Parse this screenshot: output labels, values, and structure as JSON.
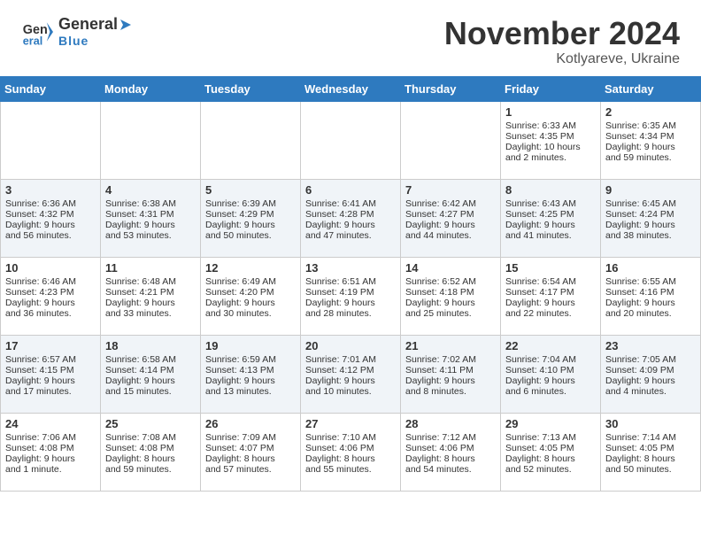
{
  "header": {
    "logo_general": "General",
    "logo_blue": "Blue",
    "month_title": "November 2024",
    "location": "Kotlyareve, Ukraine"
  },
  "weekdays": [
    "Sunday",
    "Monday",
    "Tuesday",
    "Wednesday",
    "Thursday",
    "Friday",
    "Saturday"
  ],
  "weeks": [
    [
      {
        "day": "",
        "info": ""
      },
      {
        "day": "",
        "info": ""
      },
      {
        "day": "",
        "info": ""
      },
      {
        "day": "",
        "info": ""
      },
      {
        "day": "",
        "info": ""
      },
      {
        "day": "1",
        "info": "Sunrise: 6:33 AM\nSunset: 4:35 PM\nDaylight: 10 hours\nand 2 minutes."
      },
      {
        "day": "2",
        "info": "Sunrise: 6:35 AM\nSunset: 4:34 PM\nDaylight: 9 hours\nand 59 minutes."
      }
    ],
    [
      {
        "day": "3",
        "info": "Sunrise: 6:36 AM\nSunset: 4:32 PM\nDaylight: 9 hours\nand 56 minutes."
      },
      {
        "day": "4",
        "info": "Sunrise: 6:38 AM\nSunset: 4:31 PM\nDaylight: 9 hours\nand 53 minutes."
      },
      {
        "day": "5",
        "info": "Sunrise: 6:39 AM\nSunset: 4:29 PM\nDaylight: 9 hours\nand 50 minutes."
      },
      {
        "day": "6",
        "info": "Sunrise: 6:41 AM\nSunset: 4:28 PM\nDaylight: 9 hours\nand 47 minutes."
      },
      {
        "day": "7",
        "info": "Sunrise: 6:42 AM\nSunset: 4:27 PM\nDaylight: 9 hours\nand 44 minutes."
      },
      {
        "day": "8",
        "info": "Sunrise: 6:43 AM\nSunset: 4:25 PM\nDaylight: 9 hours\nand 41 minutes."
      },
      {
        "day": "9",
        "info": "Sunrise: 6:45 AM\nSunset: 4:24 PM\nDaylight: 9 hours\nand 38 minutes."
      }
    ],
    [
      {
        "day": "10",
        "info": "Sunrise: 6:46 AM\nSunset: 4:23 PM\nDaylight: 9 hours\nand 36 minutes."
      },
      {
        "day": "11",
        "info": "Sunrise: 6:48 AM\nSunset: 4:21 PM\nDaylight: 9 hours\nand 33 minutes."
      },
      {
        "day": "12",
        "info": "Sunrise: 6:49 AM\nSunset: 4:20 PM\nDaylight: 9 hours\nand 30 minutes."
      },
      {
        "day": "13",
        "info": "Sunrise: 6:51 AM\nSunset: 4:19 PM\nDaylight: 9 hours\nand 28 minutes."
      },
      {
        "day": "14",
        "info": "Sunrise: 6:52 AM\nSunset: 4:18 PM\nDaylight: 9 hours\nand 25 minutes."
      },
      {
        "day": "15",
        "info": "Sunrise: 6:54 AM\nSunset: 4:17 PM\nDaylight: 9 hours\nand 22 minutes."
      },
      {
        "day": "16",
        "info": "Sunrise: 6:55 AM\nSunset: 4:16 PM\nDaylight: 9 hours\nand 20 minutes."
      }
    ],
    [
      {
        "day": "17",
        "info": "Sunrise: 6:57 AM\nSunset: 4:15 PM\nDaylight: 9 hours\nand 17 minutes."
      },
      {
        "day": "18",
        "info": "Sunrise: 6:58 AM\nSunset: 4:14 PM\nDaylight: 9 hours\nand 15 minutes."
      },
      {
        "day": "19",
        "info": "Sunrise: 6:59 AM\nSunset: 4:13 PM\nDaylight: 9 hours\nand 13 minutes."
      },
      {
        "day": "20",
        "info": "Sunrise: 7:01 AM\nSunset: 4:12 PM\nDaylight: 9 hours\nand 10 minutes."
      },
      {
        "day": "21",
        "info": "Sunrise: 7:02 AM\nSunset: 4:11 PM\nDaylight: 9 hours\nand 8 minutes."
      },
      {
        "day": "22",
        "info": "Sunrise: 7:04 AM\nSunset: 4:10 PM\nDaylight: 9 hours\nand 6 minutes."
      },
      {
        "day": "23",
        "info": "Sunrise: 7:05 AM\nSunset: 4:09 PM\nDaylight: 9 hours\nand 4 minutes."
      }
    ],
    [
      {
        "day": "24",
        "info": "Sunrise: 7:06 AM\nSunset: 4:08 PM\nDaylight: 9 hours\nand 1 minute."
      },
      {
        "day": "25",
        "info": "Sunrise: 7:08 AM\nSunset: 4:08 PM\nDaylight: 8 hours\nand 59 minutes."
      },
      {
        "day": "26",
        "info": "Sunrise: 7:09 AM\nSunset: 4:07 PM\nDaylight: 8 hours\nand 57 minutes."
      },
      {
        "day": "27",
        "info": "Sunrise: 7:10 AM\nSunset: 4:06 PM\nDaylight: 8 hours\nand 55 minutes."
      },
      {
        "day": "28",
        "info": "Sunrise: 7:12 AM\nSunset: 4:06 PM\nDaylight: 8 hours\nand 54 minutes."
      },
      {
        "day": "29",
        "info": "Sunrise: 7:13 AM\nSunset: 4:05 PM\nDaylight: 8 hours\nand 52 minutes."
      },
      {
        "day": "30",
        "info": "Sunrise: 7:14 AM\nSunset: 4:05 PM\nDaylight: 8 hours\nand 50 minutes."
      }
    ]
  ]
}
